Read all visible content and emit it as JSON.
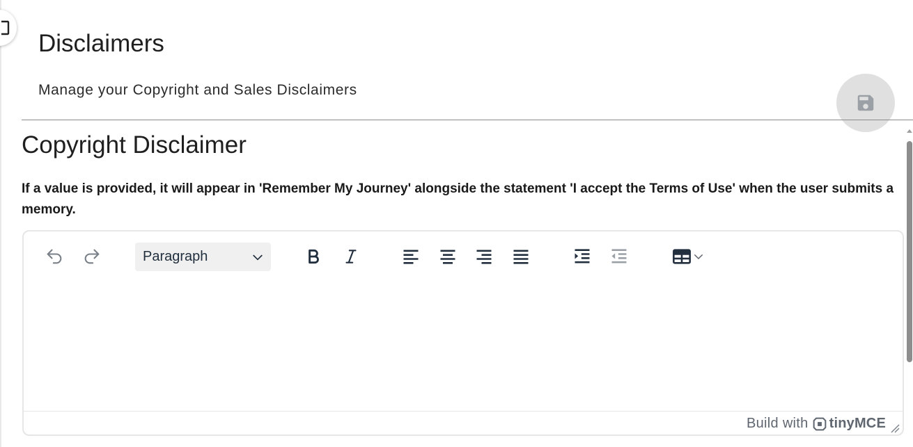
{
  "header": {
    "title": "Disclaimers",
    "subtitle": "Manage your Copyright and Sales Disclaimers",
    "save_icon": "floppy-disk-icon"
  },
  "section": {
    "title": "Copyright Disclaimer",
    "description": "If a value is provided, it will appear in 'Remember My Journey' alongside the statement 'I accept the Terms of Use' when the user submits a memory."
  },
  "editor": {
    "block_format": "Paragraph",
    "content": "",
    "toolbar_icons": [
      "undo-icon",
      "redo-icon",
      "bold-icon",
      "italic-icon",
      "align-left-icon",
      "align-center-icon",
      "align-right-icon",
      "align-justify-icon",
      "indent-icon",
      "outdent-icon",
      "table-icon"
    ],
    "branding_prefix": "Build with",
    "branding_name": "tinyMCE"
  },
  "colors": {
    "fab_bg": "#e0e0e0",
    "icon_gray": "#222f3e",
    "disabled_gray": "#9aa0a6"
  }
}
